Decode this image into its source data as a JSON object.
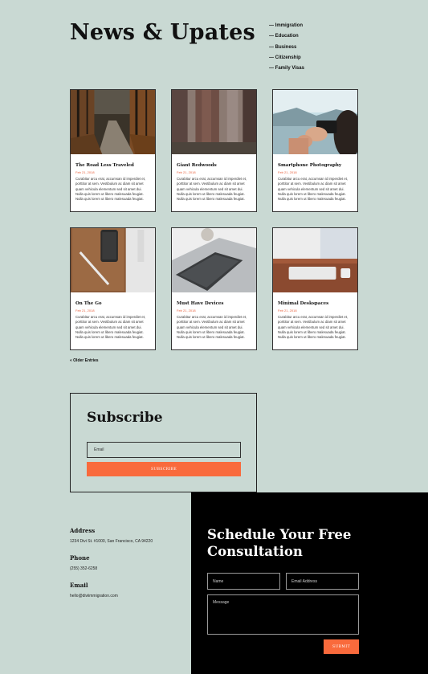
{
  "header": {
    "title": "News & Upates"
  },
  "categories": [
    "— Immigration",
    "— Education",
    "— Business",
    "— Citizenship",
    "— Family Visas"
  ],
  "posts": [
    {
      "title": "The Road Less Traveled",
      "date": "Feb 21, 2018",
      "excerpt": "Curabitur arcu erat, accumsan id imperdiet et, porttitor at sem. Vestibulum ac diam sit amet quam vehicula elementum sed sit amet dui. Nulla quis lorem ut libero malesuada feugiat. Nulla quis lorem ut libero malesuada feugiat."
    },
    {
      "title": "Giant Redwoods",
      "date": "Feb 21, 2018",
      "excerpt": "Curabitur arcu erat, accumsan id imperdiet et, porttitor at sem. Vestibulum ac diam sit amet quam vehicula elementum sed sit amet dui. Nulla quis lorem ut libero malesuada feugiat. Nulla quis lorem ut libero malesuada feugiat."
    },
    {
      "title": "Smartphone Photography",
      "date": "Feb 21, 2018",
      "excerpt": "Curabitur arcu erat, accumsan id imperdiet et, porttitor at sem. Vestibulum ac diam sit amet quam vehicula elementum sed sit amet dui. Nulla quis lorem ut libero malesuada feugiat. Nulla quis lorem ut libero malesuada feugiat."
    },
    {
      "title": "On The Go",
      "date": "Feb 21, 2018",
      "excerpt": "Curabitur arcu erat, accumsan id imperdiet et, porttitor at sem. Vestibulum ac diam sit amet quam vehicula elementum sed sit amet dui. Nulla quis lorem ut libero malesuada feugiat. Nulla quis lorem ut libero malesuada feugiat."
    },
    {
      "title": "Must Have Devices",
      "date": "Feb 21, 2018",
      "excerpt": "Curabitur arcu erat, accumsan id imperdiet et, porttitor at sem. Vestibulum ac diam sit amet quam vehicula elementum sed sit amet dui. Nulla quis lorem ut libero malesuada feugiat. Nulla quis lorem ut libero malesuada feugiat."
    },
    {
      "title": "Minimal Deskspaces",
      "date": "Feb 21, 2018",
      "excerpt": "Curabitur arcu erat, accumsan id imperdiet et, porttitor at sem. Vestibulum ac diam sit amet quam vehicula elementum sed sit amet dui. Nulla quis lorem ut libero malesuada feugiat. Nulla quis lorem ut libero malesuada feugiat."
    }
  ],
  "pagination": {
    "older_label": "« Older Entries"
  },
  "subscribe": {
    "heading": "Subscribe",
    "email_placeholder": "Email",
    "button_label": "SUBSCRIBE"
  },
  "contact": {
    "address_label": "Address",
    "address": "1234 Divi St. #1000, San Francisco, CA 94220",
    "phone_label": "Phone",
    "phone": "(255) 352-6258",
    "email_label": "Email",
    "email": "hello@diviimmigration.com"
  },
  "consultation": {
    "heading_line1": "Schedule Your Free",
    "heading_line2": "Consultation",
    "name_placeholder": "Name",
    "email_placeholder": "Email Address",
    "message_placeholder": "Message",
    "submit_label": "SUBMIT"
  },
  "colors": {
    "background": "#c9d9d3",
    "accent": "#f96a3c",
    "dark": "#000000"
  }
}
